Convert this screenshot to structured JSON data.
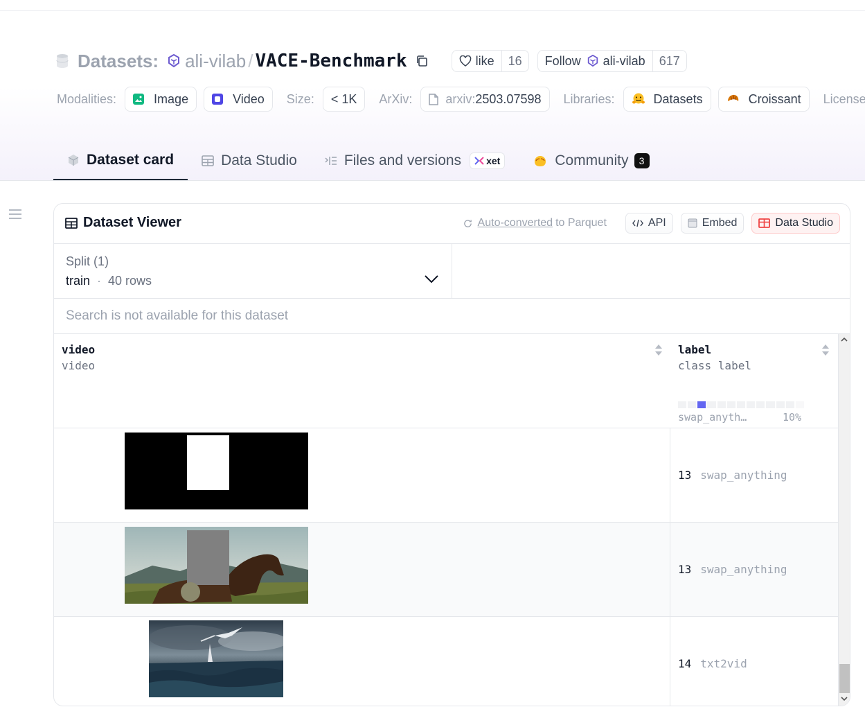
{
  "header": {
    "datasets_label": "Datasets:",
    "org": "ali-vilab",
    "slash": "/",
    "repo": "VACE-Benchmark",
    "like_label": "like",
    "like_count": "16",
    "follow_label": "Follow",
    "follow_org": "ali-vilab",
    "follow_count": "617"
  },
  "meta": {
    "modalities_label": "Modalities:",
    "modalities": [
      "Image",
      "Video"
    ],
    "size_label": "Size:",
    "size_value": "< 1K",
    "arxiv_label": "ArXiv:",
    "arxiv_prefix": "arxiv:",
    "arxiv_id": "2503.07598",
    "libraries_label": "Libraries:",
    "libraries": [
      "Datasets",
      "Croissant"
    ],
    "license_label": "License:"
  },
  "tabs": {
    "dataset_card": "Dataset card",
    "data_studio": "Data Studio",
    "files": "Files and versions",
    "xet": "xet",
    "community": "Community",
    "community_count": "3"
  },
  "viewer": {
    "title": "Dataset Viewer",
    "auto_converted": "Auto-converted",
    "to_parquet": "to Parquet",
    "api": "API",
    "embed": "Embed",
    "data_studio": "Data Studio",
    "split_label": "Split (1)",
    "split_name": "train",
    "split_dot": "·",
    "split_rows": "40 rows",
    "search_placeholder": "Search is not available for this dataset",
    "columns": [
      {
        "name": "video",
        "type": "video"
      },
      {
        "name": "label",
        "type": "class label"
      }
    ],
    "hist_label": "swap_anyth…",
    "hist_pct": "10%",
    "rows": [
      {
        "label_num": "13",
        "label_name": "swap_anything"
      },
      {
        "label_num": "13",
        "label_name": "swap_anything"
      },
      {
        "label_num": "14",
        "label_name": "txt2vid"
      }
    ]
  },
  "colors": {
    "accent_bar": "#6366f1",
    "studio_red": "#ef4444"
  }
}
